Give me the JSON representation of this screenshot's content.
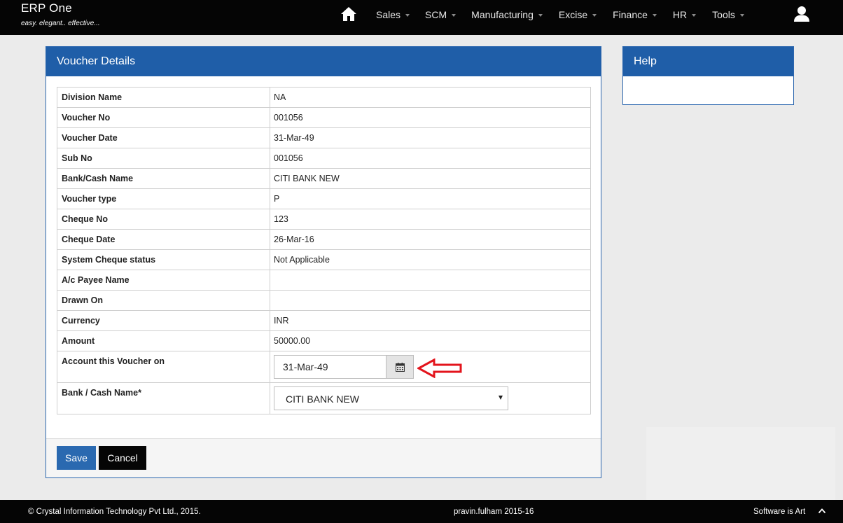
{
  "app": {
    "title": "ERP One",
    "tagline": "easy. elegant.. effective..."
  },
  "nav": {
    "items": [
      {
        "label": "Sales"
      },
      {
        "label": "SCM"
      },
      {
        "label": "Manufacturing"
      },
      {
        "label": "Excise"
      },
      {
        "label": "Finance"
      },
      {
        "label": "HR"
      },
      {
        "label": "Tools"
      }
    ],
    "icons": {
      "home": "home-icon",
      "user": "user-icon"
    }
  },
  "voucher": {
    "heading": "Voucher Details",
    "rows": [
      {
        "label": "Division Name",
        "value": "NA"
      },
      {
        "label": "Voucher No",
        "value": "001056"
      },
      {
        "label": "Voucher Date",
        "value": "31-Mar-49"
      },
      {
        "label": "Sub No",
        "value": "001056"
      },
      {
        "label": "Bank/Cash Name",
        "value": "CITI BANK NEW"
      },
      {
        "label": "Voucher type",
        "value": "P"
      },
      {
        "label": "Cheque No",
        "value": "123"
      },
      {
        "label": "Cheque Date",
        "value": "26-Mar-16"
      },
      {
        "label": "System Cheque status",
        "value": "Not Applicable"
      },
      {
        "label": "A/c Payee Name",
        "value": ""
      },
      {
        "label": "Drawn On",
        "value": ""
      },
      {
        "label": "Currency",
        "value": "INR"
      },
      {
        "label": "Amount",
        "value": "50000.00"
      }
    ],
    "account_on": {
      "label": "Account this Voucher on",
      "value": "31-Mar-49"
    },
    "bank_select": {
      "label": "Bank / Cash Name*",
      "selected": "CITI BANK NEW"
    },
    "save_label": "Save",
    "cancel_label": "Cancel"
  },
  "help": {
    "heading": "Help"
  },
  "footer": {
    "copyright": "© Crystal Information Technology Pvt Ltd., 2015.",
    "user": "pravin.fulham 2015-16",
    "tagline": "Software is Art"
  },
  "colors": {
    "navbar": "#050505",
    "panel_header": "#1f5ea8",
    "save_button": "#2a69b0",
    "annotation_arrow": "#e3141c"
  }
}
